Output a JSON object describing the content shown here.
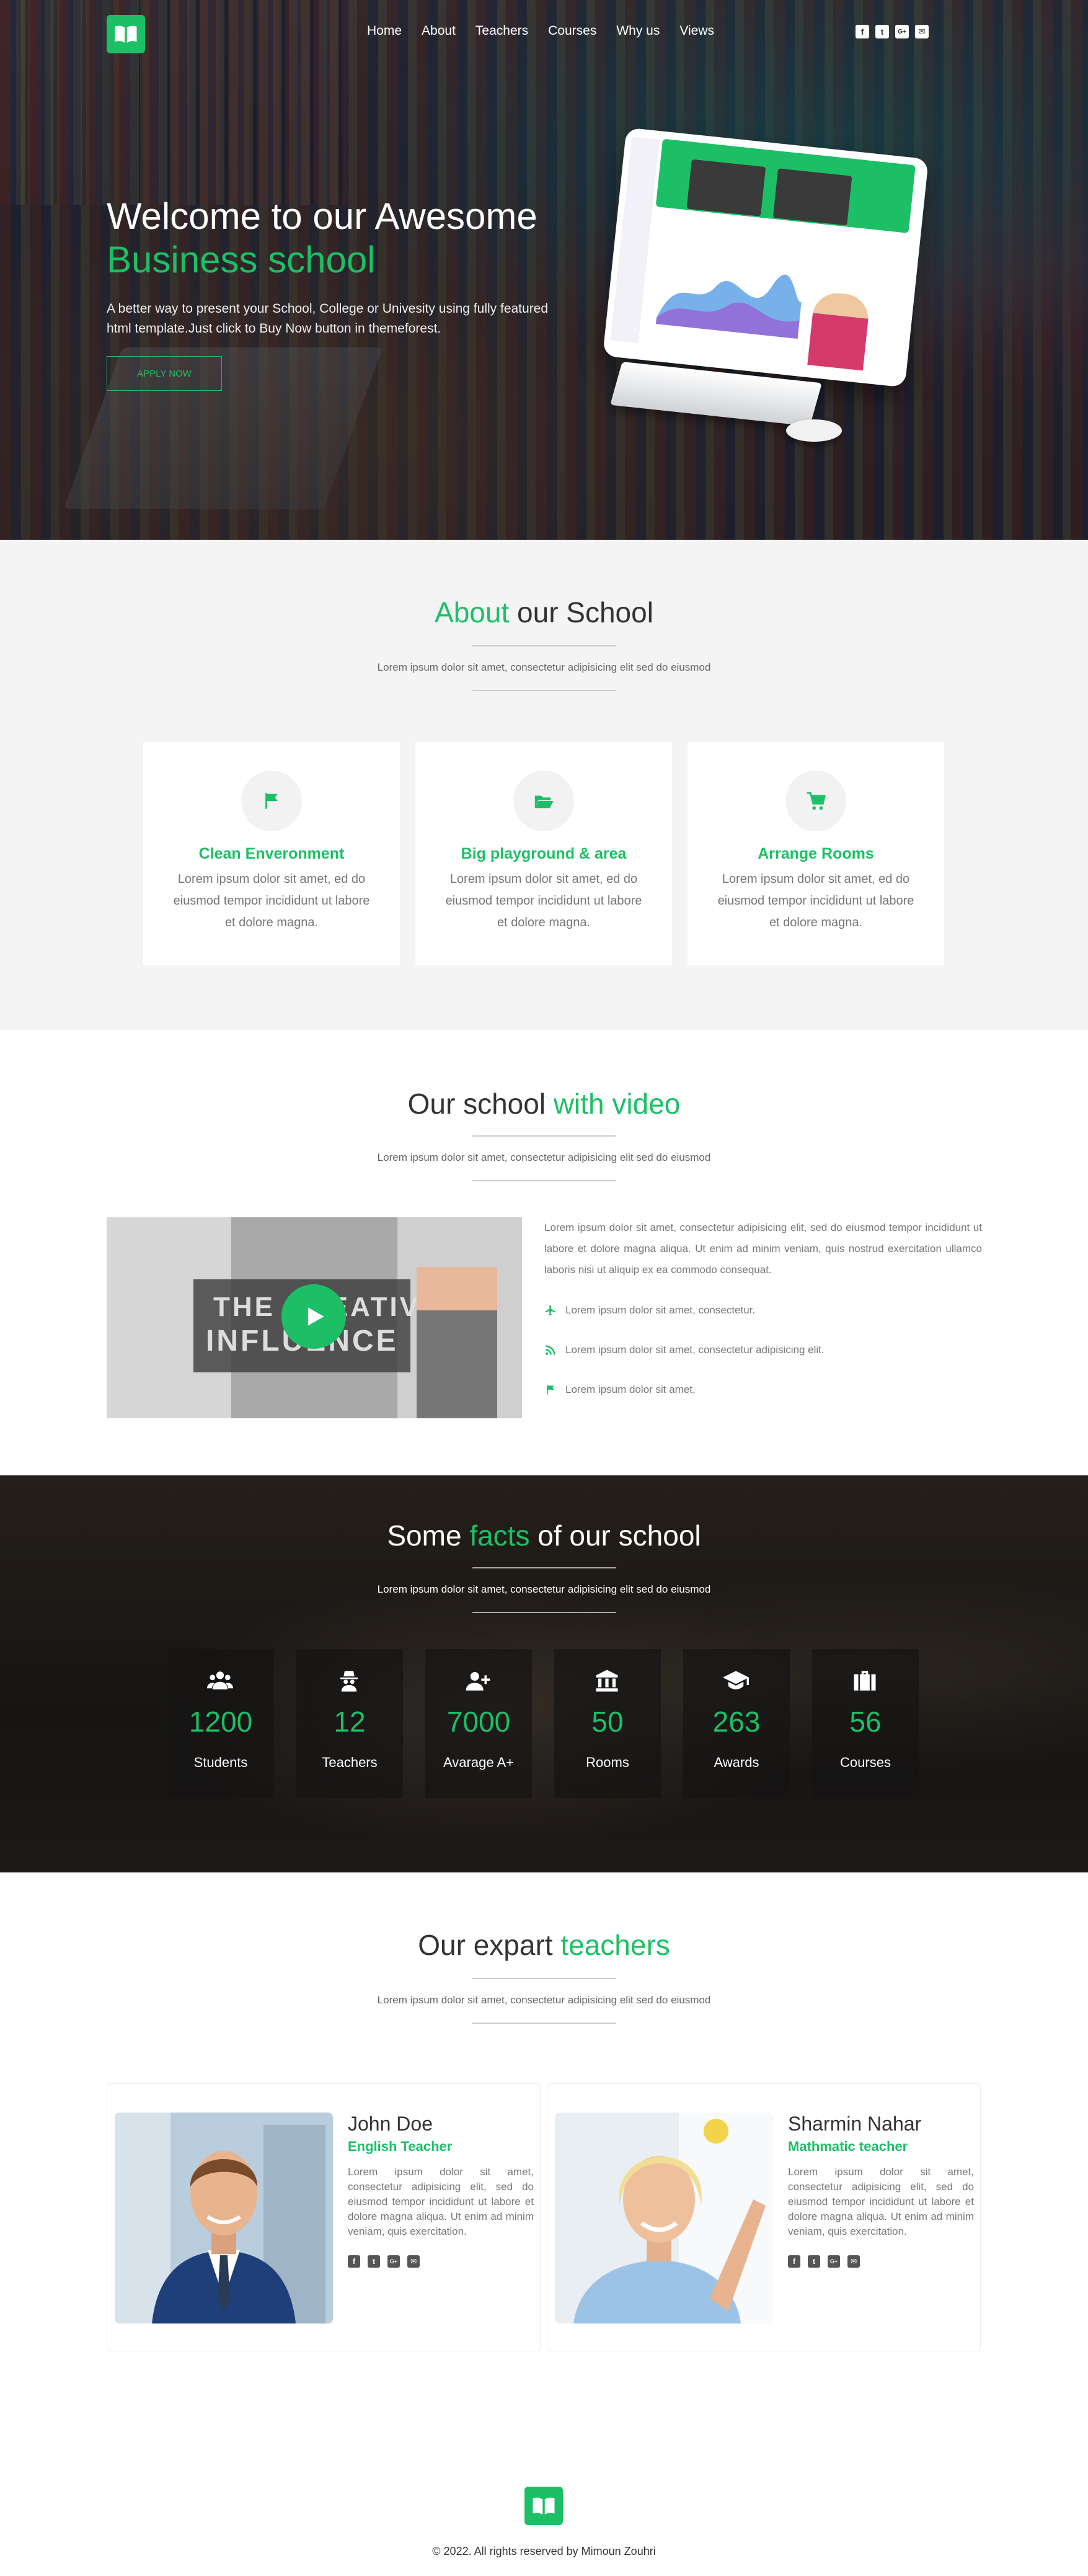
{
  "nav": {
    "items": [
      "Home",
      "About",
      "Teachers",
      "Courses",
      "Why us",
      "Views"
    ],
    "social": [
      "f",
      "t",
      "G+",
      "✉"
    ]
  },
  "hero": {
    "title_line1": "Welcome to our Awesome",
    "title_line2": "Business school",
    "text": "A better way to present your School, College or Univesity using fully featured html template.Just click to Buy Now button in themeforest.",
    "button": "APPLY NOW"
  },
  "about": {
    "title_accent": "About",
    "title_rest": " our School",
    "subtitle": "Lorem ipsum dolor sit amet, consectetur adipisicing elit sed do eiusmod",
    "cards": [
      {
        "icon": "flag-icon",
        "title": "Clean Enveronment",
        "text": "Lorem ipsum dolor sit amet, ed do eiusmod tempor incididunt ut labore et dolore magna."
      },
      {
        "icon": "folder-open-icon",
        "title": "Big playground & area",
        "text": "Lorem ipsum dolor sit amet, ed do eiusmod tempor incididunt ut labore et dolore magna."
      },
      {
        "icon": "cart-icon",
        "title": "Arrange Rooms",
        "text": "Lorem ipsum dolor sit amet, ed do eiusmod tempor incididunt ut labore et dolore magna."
      }
    ]
  },
  "video": {
    "title_rest": "Our school ",
    "title_accent": "with video",
    "subtitle": "Lorem ipsum dolor sit amet, consectetur adipisicing elit sed do eiusmod",
    "thumb_line1": "THE CREATIVE",
    "thumb_line2": "INFLUENCE",
    "paragraph": "Lorem ipsum dolor sit amet, consectetur adipisicing elit, sed do eiusmod tempor incididunt ut labore et dolore magna aliqua. Ut enim ad minim veniam, quis nostrud exercitation ullamco laboris nisi ut aliquip ex ea commodo consequat.",
    "items": [
      {
        "icon": "plane-icon",
        "text": "Lorem ipsum dolor sit amet, consectetur."
      },
      {
        "icon": "rss-icon",
        "text": "Lorem ipsum dolor sit amet, consectetur adipisicing elit."
      },
      {
        "icon": "flag-icon",
        "text": "Lorem ipsum dolor sit amet,"
      }
    ]
  },
  "facts": {
    "title_pre": "Some ",
    "title_accent": "facts",
    "title_post": " of our school",
    "subtitle": "Lorem ipsum dolor sit amet, consectetur adipisicing elit sed do eiusmod",
    "items": [
      {
        "icon": "users-icon",
        "number": "1200",
        "label": "Students"
      },
      {
        "icon": "user-secret-icon",
        "number": "12",
        "label": "Teachers"
      },
      {
        "icon": "user-plus-icon",
        "number": "7000",
        "label": "Avarage A+"
      },
      {
        "icon": "bank-icon",
        "number": "50",
        "label": "Rooms"
      },
      {
        "icon": "graduation-cap-icon",
        "number": "263",
        "label": "Awards"
      },
      {
        "icon": "briefcase-icon",
        "number": "56",
        "label": "Courses"
      }
    ]
  },
  "teachers": {
    "title_rest": "Our expart ",
    "title_accent": "teachers",
    "subtitle": "Lorem ipsum dolor sit amet, consectetur adipisicing elit sed do eiusmod",
    "list": [
      {
        "name": "John Doe",
        "role": "English Teacher",
        "bio": "Lorem ipsum dolor sit amet, consectetur adipisicing elit, sed do eiusmod tempor incididunt ut labore et dolore magna aliqua. Ut enim ad minim veniam, quis exercitation."
      },
      {
        "name": "Sharmin Nahar",
        "role": "Mathmatic teacher",
        "bio": "Lorem ipsum dolor sit amet, consectetur adipisicing elit, sed do eiusmod tempor incididunt ut labore et dolore magna aliqua. Ut enim ad minim veniam, quis exercitation."
      }
    ],
    "social": [
      "f",
      "t",
      "G+",
      "✉"
    ]
  },
  "footer": {
    "copyright": "© 2022. All rights reserved by Mimoun Zouhri"
  },
  "colors": {
    "accent": "#1dbf66",
    "dark": "#333333",
    "light_bg": "#f4f4f4"
  }
}
